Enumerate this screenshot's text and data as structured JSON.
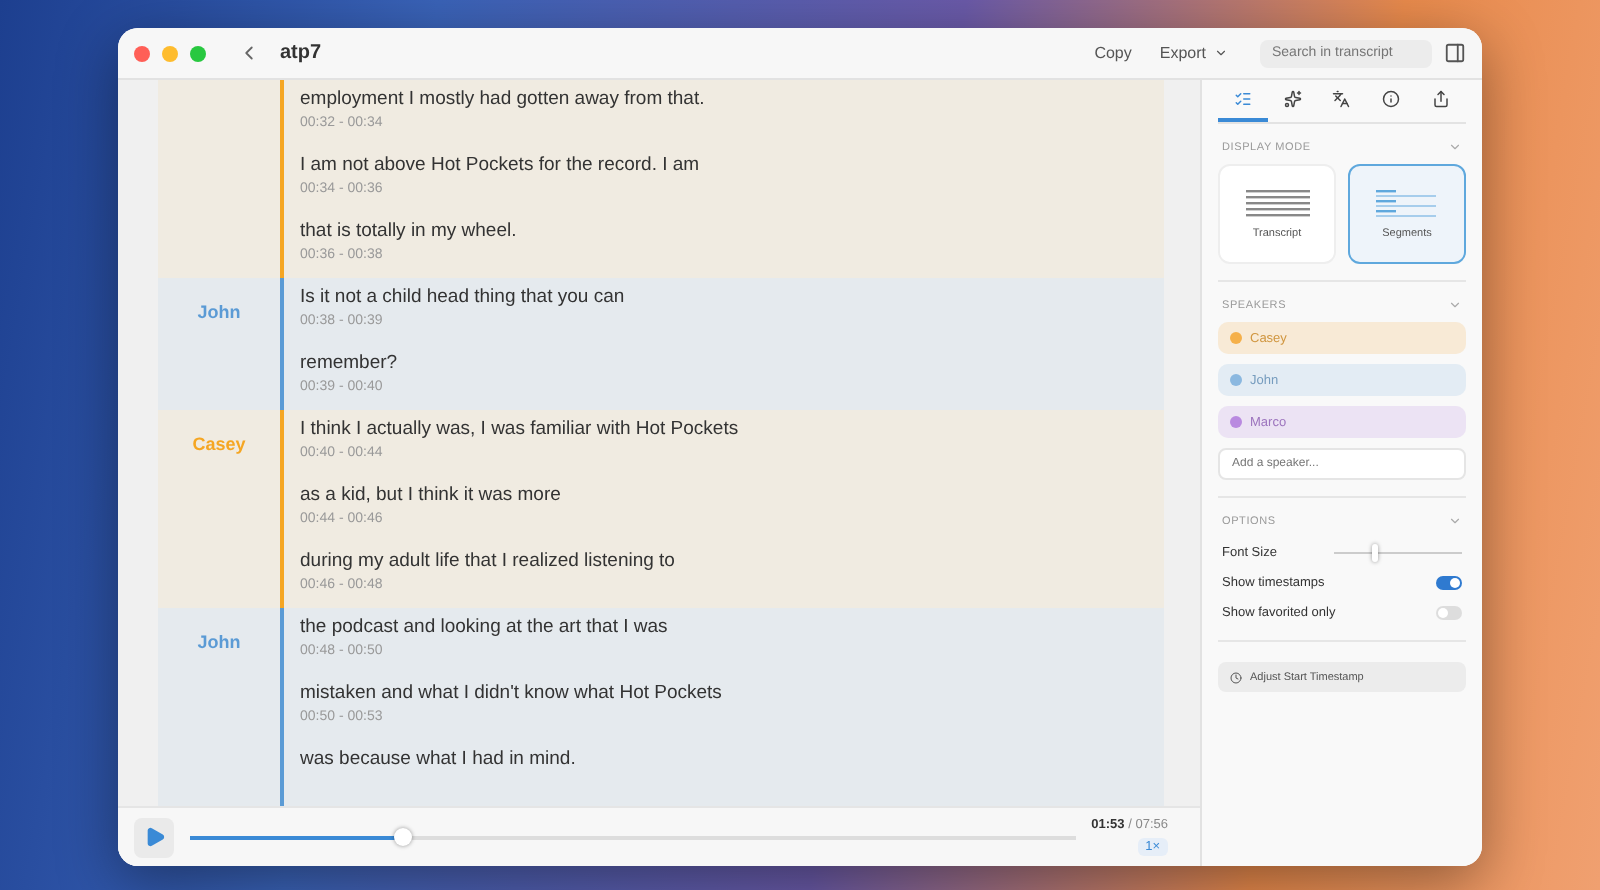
{
  "window": {
    "title": "atp7"
  },
  "toolbar": {
    "copy": "Copy",
    "export": "Export",
    "search_placeholder": "Search in transcript"
  },
  "groups": [
    {
      "color": "#f5a623",
      "lines": [
        {
          "text": "employment I mostly had gotten away from that.",
          "time": "00:32 - 00:34"
        },
        {
          "text": "I am not above Hot Pockets for the record. I am",
          "time": "00:34 - 00:36"
        },
        {
          "text": "that is totally in my wheel.",
          "time": "00:36 - 00:38"
        }
      ]
    },
    {
      "speaker": "John",
      "color": "#5b9bd5",
      "lines": [
        {
          "text": "Is it not a child head thing that you can",
          "time": "00:38 - 00:39"
        },
        {
          "text": "remember?",
          "time": "00:39 - 00:40"
        }
      ]
    },
    {
      "speaker": "Casey",
      "color": "#f5a623",
      "lines": [
        {
          "text": "I think I actually was, I was familiar with Hot Pockets",
          "time": "00:40 - 00:44"
        },
        {
          "text": "as a kid, but I think it was more",
          "time": "00:44 - 00:46"
        },
        {
          "text": "during my adult life that I realized listening to",
          "time": "00:46 - 00:48"
        }
      ]
    },
    {
      "speaker": "John",
      "color": "#5b9bd5",
      "lines": [
        {
          "text": "the podcast and looking at the art that I was",
          "time": "00:48 - 00:50"
        },
        {
          "text": "mistaken and what I didn't know what Hot Pockets",
          "time": "00:50 - 00:53"
        },
        {
          "text": "was because what I had in mind."
        }
      ]
    }
  ],
  "player": {
    "level": 0.24,
    "current": "01:53",
    "separator": "/",
    "total": "07:56",
    "speed": "1×"
  },
  "sidebar": {
    "tabs": [
      {
        "kind": "list",
        "selected": true
      },
      {
        "kind": "sparkle",
        "selected": false
      },
      {
        "kind": "translate",
        "selected": false
      },
      {
        "kind": "info",
        "selected": false
      },
      {
        "kind": "share",
        "selected": false
      }
    ],
    "display_mode": {
      "title": "DISPLAY MODE",
      "options": [
        {
          "label": "Transcript",
          "kind": "lines",
          "selected": false
        },
        {
          "label": "Segments",
          "kind": "segments",
          "selected": true
        }
      ]
    },
    "speakers": {
      "title": "SPEAKERS",
      "items": [
        {
          "name": "Casey",
          "color": "#f5b04a"
        },
        {
          "name": "John",
          "color": "#8bb8e0"
        },
        {
          "name": "Marco",
          "color": "#b98ae0"
        }
      ],
      "placeholder": "Add a speaker..."
    },
    "options": {
      "title": "OPTIONS",
      "font_size": {
        "label": "Font Size",
        "level": 0.3
      },
      "toggles": [
        {
          "label": "Show timestamps",
          "on": true
        },
        {
          "label": "Show favorited only",
          "on": false
        }
      ]
    },
    "adjust": "Adjust Start Timestamp"
  }
}
